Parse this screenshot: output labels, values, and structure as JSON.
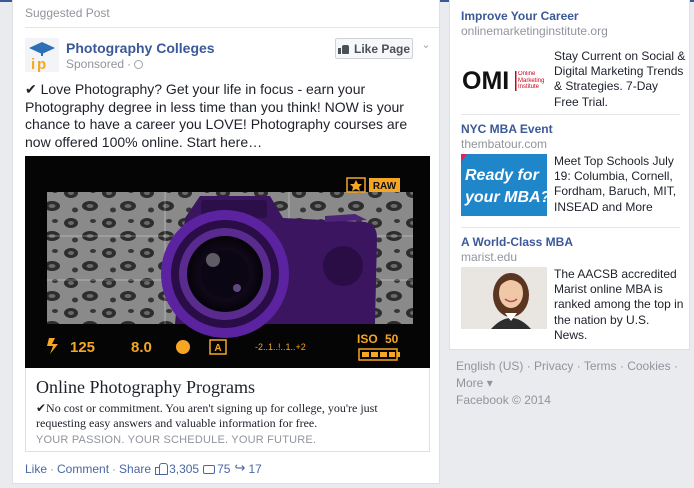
{
  "post": {
    "suggested_label": "Suggested Post",
    "page_name": "Photography Colleges",
    "sponsored_label": "Sponsored",
    "like_page_label": "Like Page",
    "body_text": "✔ Love Photography? Get your life in focus - earn your Photography degree in less time than you think! NOW is your chance to have a career you LOVE! Photography courses are now offered 100% online. Start here…",
    "image_overlay": {
      "raw_label": "RAW",
      "shutter": "125",
      "aperture": "8.0",
      "mode": "A",
      "meter": "-2..1..!..1..+2",
      "iso_label": "ISO",
      "iso_value": "50"
    },
    "ad_title": "Online Photography Programs",
    "ad_description": "✔No cost or commitment. You aren't signing up for college, you're just requesting easy answers and valuable information for free.",
    "ad_caption": "YOUR PASSION. YOUR SCHEDULE. YOUR FUTURE.",
    "actions": {
      "like": "Like",
      "comment": "Comment",
      "share": "Share"
    },
    "counts": {
      "likes": "3,305",
      "comments": "75",
      "shares": "17"
    }
  },
  "sidebar_ads": [
    {
      "title": "Improve Your Career",
      "domain": "onlinemarketinginstitute.org",
      "body": "Stay Current on Social & Digital Marketing Trends & Strategies. 7-Day Free Trial.",
      "logo_text": "OMI",
      "logo_sub": "Online Marketing Institute"
    },
    {
      "title": "NYC MBA Event",
      "domain": "thembatour.com",
      "body": "Meet Top Schools July 19: Columbia, Cornell, Fordham, Baruch, MIT, INSEAD and More",
      "image_text_1": "Ready for",
      "image_text_2": "your MBA?"
    },
    {
      "title": "A World-Class MBA",
      "domain": "marist.edu",
      "body": "The AACSB accredited Marist online MBA is ranked among the top in the nation by U.S. News."
    }
  ],
  "footer": {
    "language": "English (US)",
    "privacy": "Privacy",
    "terms": "Terms",
    "cookies": "Cookies",
    "more": "More",
    "copyright": "Facebook © 2014"
  },
  "colors": {
    "brand": "#3b5998",
    "camera_purple": "#6a2fa0",
    "overlay_orange": "#f5a623",
    "mba_blue": "#1f86c9"
  }
}
